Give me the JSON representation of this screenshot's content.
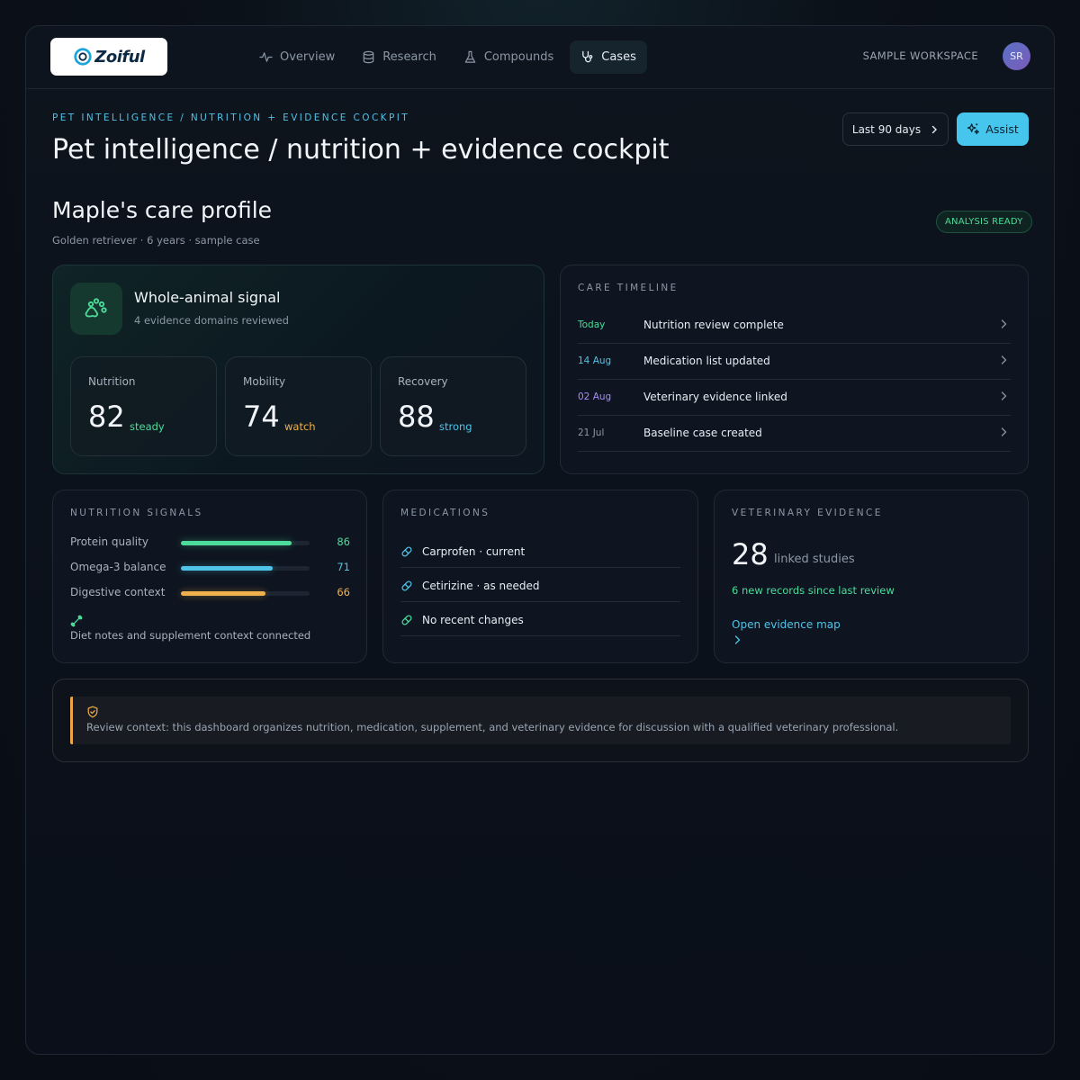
{
  "app": {
    "logo_text": "Zoiful"
  },
  "nav": {
    "items": [
      {
        "label": "Overview",
        "icon": "activity-icon"
      },
      {
        "label": "Research",
        "icon": "database-icon"
      },
      {
        "label": "Compounds",
        "icon": "flask-icon"
      },
      {
        "label": "Cases",
        "icon": "stethoscope-icon",
        "active": true
      }
    ]
  },
  "header": {
    "workspace": "SAMPLE WORKSPACE",
    "avatar_initials": "SR"
  },
  "page": {
    "eyebrow": "PET INTELLIGENCE / NUTRITION + EVIDENCE COCKPIT",
    "title": "Pet intelligence / nutrition + evidence cockpit",
    "range_button": "Last 90 days",
    "assist_button": "Assist"
  },
  "profile": {
    "title": "Maple's care profile",
    "subtitle": "Golden retriever · 6 years · sample case",
    "status": "ANALYSIS READY"
  },
  "signal": {
    "title": "Whole-animal signal",
    "subtitle": "4 evidence domains reviewed",
    "metrics": [
      {
        "label": "Nutrition",
        "value": "82",
        "note": "steady",
        "color": "#4ddc9a"
      },
      {
        "label": "Mobility",
        "value": "74",
        "note": "watch",
        "color": "#f0b04e"
      },
      {
        "label": "Recovery",
        "value": "88",
        "note": "strong",
        "color": "#4fc3e8"
      }
    ]
  },
  "timeline": {
    "label": "CARE TIMELINE",
    "items": [
      {
        "date": "Today",
        "text": "Nutrition review complete",
        "color": "#4ddc9a"
      },
      {
        "date": "14 Aug",
        "text": "Medication list updated",
        "color": "#4fc3e8"
      },
      {
        "date": "02 Aug",
        "text": "Veterinary evidence linked",
        "color": "#a78bfa"
      },
      {
        "date": "21 Jul",
        "text": "Baseline case created",
        "color": "#8c97a6"
      }
    ]
  },
  "nutrition_signals": {
    "label": "NUTRITION SIGNALS",
    "items": [
      {
        "label": "Protein quality",
        "value": "86",
        "fraction": 0.86,
        "color": "#4ddc9a"
      },
      {
        "label": "Omega-3 balance",
        "value": "71",
        "fraction": 0.71,
        "color": "#4fc3e8"
      },
      {
        "label": "Digestive context",
        "value": "66",
        "fraction": 0.66,
        "color": "#f0b04e"
      }
    ],
    "note": "Diet notes and supplement context connected"
  },
  "medications": {
    "label": "MEDICATIONS",
    "items": [
      {
        "text": "Carprofen · current"
      },
      {
        "text": "Cetirizine · as needed"
      },
      {
        "text": "No recent changes"
      }
    ]
  },
  "evidence": {
    "label": "VETERINARY EVIDENCE",
    "count": "28",
    "unit": "linked studies",
    "new_records": "6 new records since last review",
    "link": "Open evidence map"
  },
  "context": {
    "text": "Review context: this dashboard organizes nutrition, medication, supplement, and veterinary evidence for discussion with a qualified veterinary professional."
  }
}
